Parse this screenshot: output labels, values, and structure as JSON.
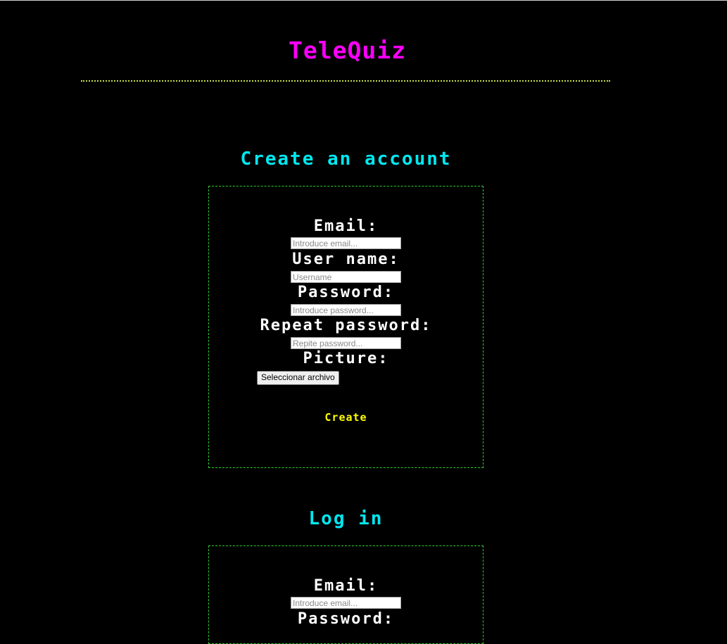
{
  "header": {
    "title": "TeleQuiz"
  },
  "register": {
    "heading": "Create an account",
    "email_label": "Email:",
    "email_placeholder": "Introduce email...",
    "username_label": "User name:",
    "username_placeholder": "Username",
    "password_label": "Password:",
    "password_placeholder": "Introduce password...",
    "repeat_label": "Repeat password:",
    "repeat_placeholder": "Repite password...",
    "picture_label": "Picture:",
    "file_button_label": "Seleccionar archivo",
    "submit_label": "Create"
  },
  "login": {
    "heading": "Log in",
    "email_label": "Email:",
    "email_placeholder": "Introduce email...",
    "password_label": "Password:"
  },
  "colors": {
    "background": "#000000",
    "title": "#ff00ff",
    "heading": "#00e8f0",
    "label": "#ffffff",
    "submit": "#ffff00",
    "box_border": "#2ecc2e",
    "rule": "#c6e04a"
  }
}
